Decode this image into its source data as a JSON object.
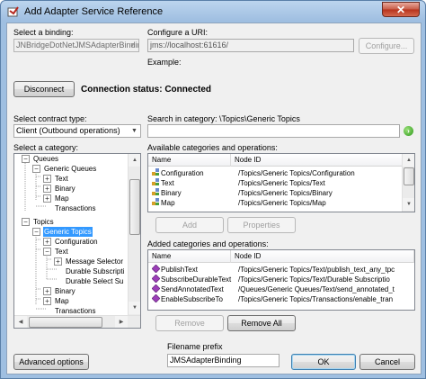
{
  "window": {
    "title": "Add Adapter Service Reference",
    "close_glyph": "✕"
  },
  "binding": {
    "label": "Select a binding:",
    "value": "JNBridgeDotNetJMSAdapterBinding"
  },
  "uri": {
    "label": "Configure a URI:",
    "value": "jms://localhost:61616/",
    "configure_label": "Configure...",
    "example_label": "Example:"
  },
  "connection": {
    "disconnect_label": "Disconnect",
    "status_text": "Connection status:  Connected"
  },
  "contract": {
    "label": "Select contract type:",
    "value": "Client (Outbound operations)"
  },
  "search": {
    "label": "Search in category: \\Topics\\Generic Topics",
    "value": ""
  },
  "category": {
    "label": "Select a category:",
    "tree": [
      {
        "label": "Queues",
        "expander": "−"
      },
      {
        "label": "Generic Queues",
        "expander": "−"
      },
      {
        "label": "Text",
        "expander": "+"
      },
      {
        "label": "Binary",
        "expander": "+"
      },
      {
        "label": "Map",
        "expander": "+"
      },
      {
        "label": "Transactions",
        "expander": ""
      },
      {
        "label": "Topics",
        "expander": "−"
      },
      {
        "label": "Generic Topics",
        "expander": "−"
      },
      {
        "label": "Configuration",
        "expander": "+"
      },
      {
        "label": "Text",
        "expander": "−"
      },
      {
        "label": "Message Selector",
        "expander": "+"
      },
      {
        "label": "Durable Subscripti",
        "expander": ""
      },
      {
        "label": "Durable Select Su",
        "expander": ""
      },
      {
        "label": "Binary",
        "expander": "+"
      },
      {
        "label": "Map",
        "expander": "+"
      },
      {
        "label": "Transactions",
        "expander": ""
      }
    ]
  },
  "available": {
    "label": "Available categories and operations:",
    "columns": [
      "Name",
      "Node ID"
    ],
    "rows": [
      {
        "name": "Configuration",
        "node_id": "/Topics/Generic Topics/Configuration"
      },
      {
        "name": "Text",
        "node_id": "/Topics/Generic Topics/Text"
      },
      {
        "name": "Binary",
        "node_id": "/Topics/Generic Topics/Binary"
      },
      {
        "name": "Map",
        "node_id": "/Topics/Generic Topics/Map"
      }
    ],
    "add_label": "Add",
    "properties_label": "Properties"
  },
  "added": {
    "label": "Added categories and operations:",
    "columns": [
      "Name",
      "Node ID"
    ],
    "rows": [
      {
        "name": "PublishText",
        "node_id": "/Topics/Generic Topics/Text/publish_text_any_tpc"
      },
      {
        "name": "SubscribeDurableText",
        "node_id": "/Topics/Generic Topics/Text/Durable Subscriptio"
      },
      {
        "name": "SendAnnotatedText",
        "node_id": "/Queues/Generic Queues/Text/send_annotated_t"
      },
      {
        "name": "EnableSubscribeTo",
        "node_id": "/Topics/Generic Topics/Transactions/enable_tran"
      }
    ],
    "remove_label": "Remove",
    "remove_all_label": "Remove All"
  },
  "footer": {
    "advanced_label": "Advanced options",
    "filename_label": "Filename prefix",
    "filename_value": "JMSAdapterBinding",
    "ok_label": "OK",
    "cancel_label": "Cancel"
  },
  "colors": {
    "selection": "#3399ff",
    "titlebar": "#bcd5ee",
    "close": "#c75a45"
  }
}
